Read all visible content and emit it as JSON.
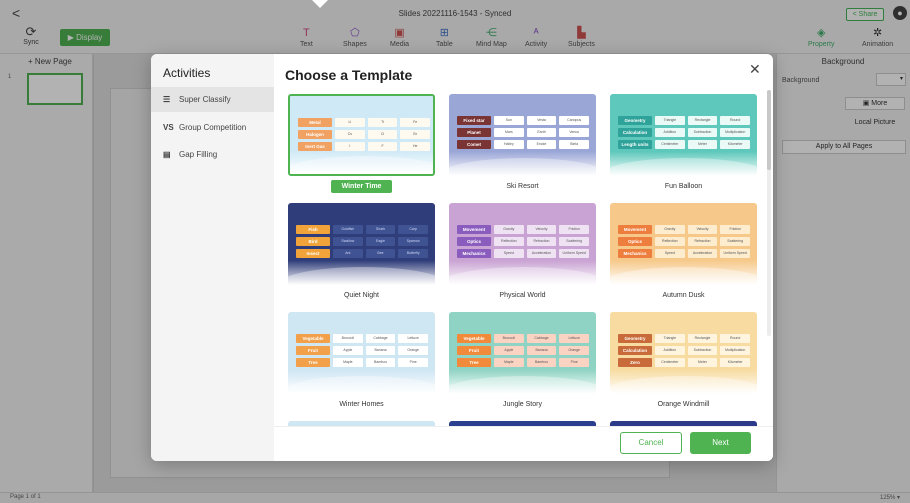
{
  "app": {
    "doc_title": "Slides 20221116-1543 - Synced",
    "share_label": "Share",
    "sync_label": "Sync",
    "display_label": "Display",
    "back_glyph": "<",
    "user_glyph": "●"
  },
  "toolbar": {
    "items": [
      {
        "label": "Text",
        "icon": "T",
        "name": "text"
      },
      {
        "label": "Shapes",
        "icon": "⬠",
        "name": "shapes"
      },
      {
        "label": "Media",
        "icon": "▣",
        "name": "media"
      },
      {
        "label": "Table",
        "icon": "⊞",
        "name": "table"
      },
      {
        "label": "Mind Map",
        "icon": "⋲",
        "name": "mind-map"
      },
      {
        "label": "Activity",
        "icon": "ᴬ",
        "name": "activity"
      },
      {
        "label": "Subjects",
        "icon": "▙",
        "name": "subjects"
      }
    ],
    "right_items": [
      {
        "label": "Property",
        "icon": "◈"
      },
      {
        "label": "Animation",
        "icon": "✲"
      }
    ]
  },
  "left_panel": {
    "new_page": "+ New Page",
    "thumb_number": "1"
  },
  "right_panel": {
    "title": "Background",
    "bg_label": "Background",
    "more_label": "More",
    "local_label": "Local Picture",
    "apply_label": "Apply to All Pages"
  },
  "status": {
    "page_info": "Page 1 of 1",
    "zoom": "125%"
  },
  "dialog": {
    "sidebar_title": "Activities",
    "activities": [
      {
        "label": "Super Classify",
        "icon": "☰"
      },
      {
        "label": "Group Competition",
        "icon": "VS"
      },
      {
        "label": "Gap Filling",
        "icon": "▤"
      }
    ],
    "title": "Choose a Template",
    "close_glyph": "✕",
    "cancel_label": "Cancel",
    "next_label": "Next",
    "templates": [
      {
        "name": "Winter Time",
        "selected": true,
        "bg": "#cfe9f6",
        "tag": "#f1a262",
        "tags": [
          "Metal",
          "Halogen",
          "Inert Gas"
        ],
        "cells": [
          [
            "Li",
            "Ti",
            "Fe"
          ],
          [
            "Cs",
            "Cl",
            "Br"
          ],
          [
            "I",
            "F",
            "He"
          ]
        ],
        "cell_bg": "#fffaf0"
      },
      {
        "name": "Ski Resort",
        "selected": false,
        "bg": "#9aa6d6",
        "tag": "#7a3434",
        "tags": [
          "Fixed star",
          "Planet",
          "Comet"
        ],
        "cells": [
          [
            "Sun",
            "Vesta",
            "Canopus"
          ],
          [
            "Mars",
            "Earth",
            "Venus"
          ],
          [
            "Halley",
            "Encke",
            "Biela"
          ]
        ],
        "cell_bg": "#ffffff"
      },
      {
        "name": "Fun Balloon",
        "selected": false,
        "bg": "#5dc8bb",
        "tag": "#2fa39a",
        "tags": [
          "Geometry",
          "Calculation",
          "Length units"
        ],
        "cells": [
          [
            "Triangle",
            "Rectangle",
            "Round"
          ],
          [
            "Addition",
            "Subtraction",
            "Multiplication"
          ],
          [
            "Centimeter",
            "Meter",
            "Kilometer"
          ]
        ],
        "cell_bg": "#eafaf6"
      },
      {
        "name": "Quiet Night",
        "selected": false,
        "bg": "#2f3d7a",
        "tag": "#f2a43a",
        "tags": [
          "Fish",
          "Bird",
          "Insect"
        ],
        "cells": [
          [
            "Goldfish",
            "Shark",
            "Carp"
          ],
          [
            "Swallow",
            "Eagle",
            "Sparrow"
          ],
          [
            "Ant",
            "Bee",
            "Butterfly"
          ]
        ],
        "cell_bg": "#3f5393"
      },
      {
        "name": "Physical World",
        "selected": false,
        "bg": "#c9a3d3",
        "tag": "#8a5cbd",
        "tags": [
          "Movement",
          "Optics",
          "Mechanics"
        ],
        "cells": [
          [
            "Gravity",
            "Velocity",
            "Friction"
          ],
          [
            "Reflection",
            "Refraction",
            "Scattering"
          ],
          [
            "Speed",
            "Acceleration",
            "Uniform Speed"
          ]
        ],
        "cell_bg": "#efe2f3"
      },
      {
        "name": "Autumn Dusk",
        "selected": false,
        "bg": "#f6c98a",
        "tag": "#ee7e3e",
        "tags": [
          "Movement",
          "Optics",
          "Mechanics"
        ],
        "cells": [
          [
            "Gravity",
            "Velocity",
            "Friction"
          ],
          [
            "Reflection",
            "Refraction",
            "Scattering"
          ],
          [
            "Speed",
            "Acceleration",
            "Uniform Speed"
          ]
        ],
        "cell_bg": "#fdeccd"
      },
      {
        "name": "Winter Homes",
        "selected": false,
        "bg": "#cfe6f3",
        "tag": "#f2a04a",
        "tags": [
          "Vegetable",
          "Fruit",
          "Tree"
        ],
        "cells": [
          [
            "Broccoli",
            "Cabbage",
            "Lettuce"
          ],
          [
            "Apple",
            "Banana",
            "Orange"
          ],
          [
            "Maple",
            "Bamboo",
            "Pine"
          ]
        ],
        "cell_bg": "#ffffff"
      },
      {
        "name": "Jungle Story",
        "selected": false,
        "bg": "#8ed3c3",
        "tag": "#f28a3c",
        "tags": [
          "Vegetable",
          "Fruit",
          "Tree"
        ],
        "cells": [
          [
            "Broccoli",
            "Cabbage",
            "Lettuce"
          ],
          [
            "Apple",
            "Banana",
            "Orange"
          ],
          [
            "Maple",
            "Bamboo",
            "Pine"
          ]
        ],
        "cell_bg": "#fbd3c2"
      },
      {
        "name": "Orange Windmill",
        "selected": false,
        "bg": "#f7dba0",
        "tag": "#c96a3a",
        "tags": [
          "Geometry",
          "Calculation",
          "Zero"
        ],
        "cells": [
          [
            "Triangle",
            "Rectangle",
            "Round"
          ],
          [
            "Addition",
            "Subtraction",
            "Multiplication"
          ],
          [
            "Centimeter",
            "Meter",
            "Kilometer"
          ]
        ],
        "cell_bg": "#fff5de"
      }
    ]
  }
}
